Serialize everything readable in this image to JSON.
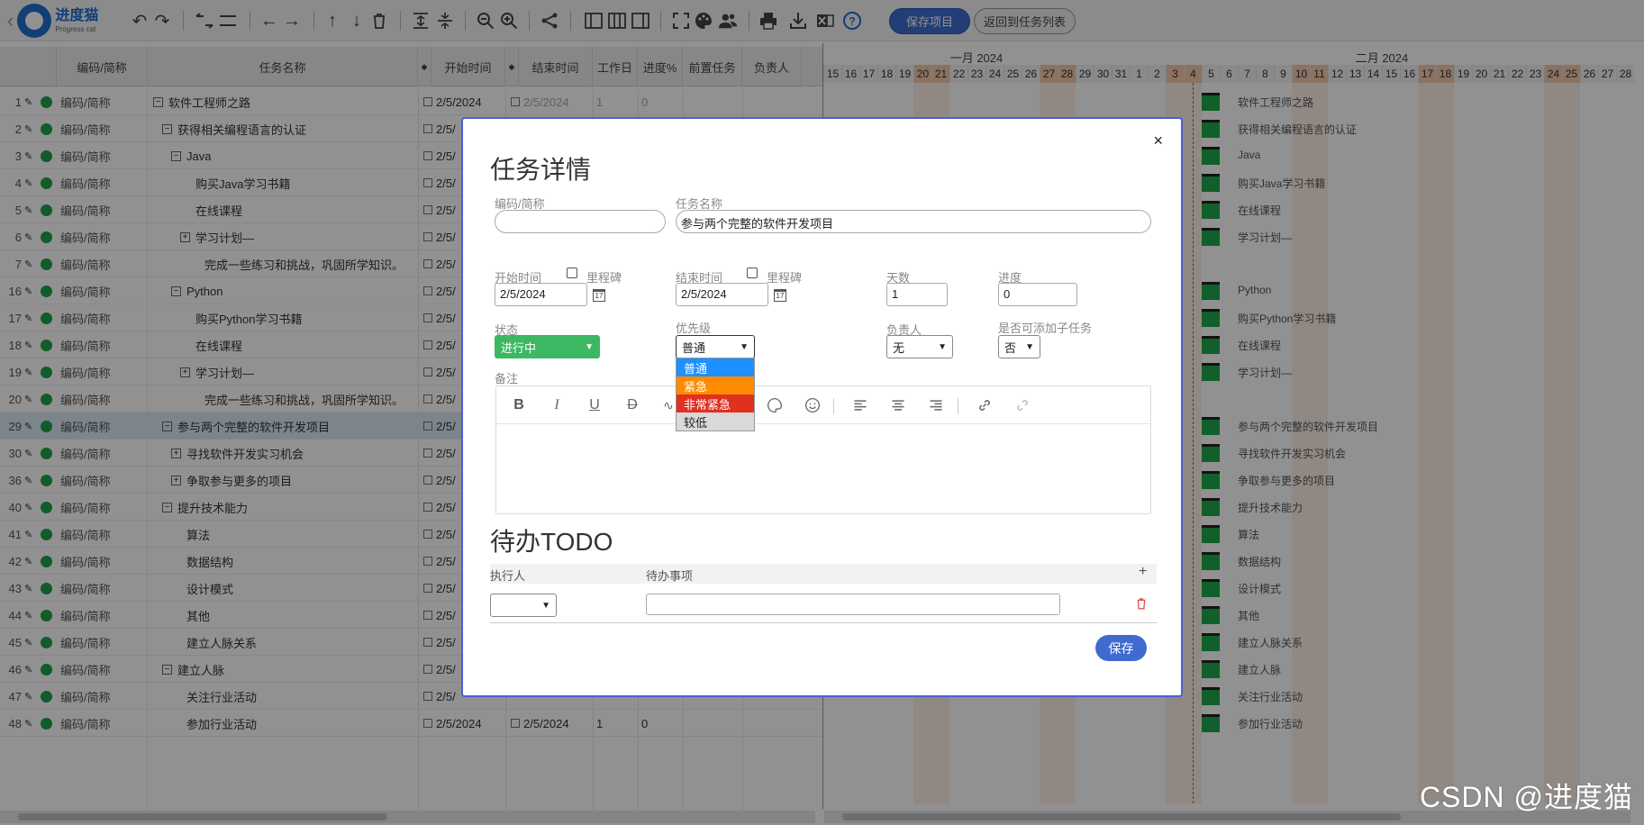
{
  "app": {
    "logo_cn": "进度猫",
    "logo_en": "Progress cat",
    "save_project_label": "保存项目",
    "return_label": "返回到任务列表"
  },
  "grid": {
    "columns": {
      "code": "编码/简称",
      "name": "任务名称",
      "start": "开始时间",
      "end": "结束时间",
      "workdays": "工作日",
      "progress": "进度%",
      "predecessor": "前置任务",
      "owner": "负责人"
    },
    "rows": [
      {
        "id": "1",
        "code": "编码/简称",
        "name": "软件工程师之路",
        "indent": 0,
        "toggle": "−",
        "start": "2/5/2024",
        "end": "2/5/2024",
        "wd": "1",
        "progress": "0"
      },
      {
        "id": "2",
        "code": "编码/简称",
        "name": "获得相关编程语言的认证",
        "indent": 1,
        "toggle": "−",
        "start": "2/5/"
      },
      {
        "id": "3",
        "code": "编码/简称",
        "name": "Java",
        "indent": 2,
        "toggle": "−",
        "start": "2/5/"
      },
      {
        "id": "4",
        "code": "编码/简称",
        "name": "购买Java学习书籍",
        "indent": 3,
        "toggle": "",
        "start": "2/5/"
      },
      {
        "id": "5",
        "code": "编码/简称",
        "name": "在线课程",
        "indent": 3,
        "toggle": "",
        "start": "2/5/"
      },
      {
        "id": "6",
        "code": "编码/简称",
        "name": "学习计划—",
        "indent": 3,
        "toggle": "+",
        "start": "2/5/"
      },
      {
        "id": "7",
        "code": "编码/简称",
        "name": "完成一些练习和挑战，巩固所学知识。",
        "indent": 4,
        "toggle": "",
        "start": "2/5/"
      },
      {
        "id": "16",
        "code": "编码/简称",
        "name": "Python",
        "indent": 2,
        "toggle": "−",
        "start": "2/5/"
      },
      {
        "id": "17",
        "code": "编码/简称",
        "name": "购买Python学习书籍",
        "indent": 3,
        "toggle": "",
        "start": "2/5/"
      },
      {
        "id": "18",
        "code": "编码/简称",
        "name": "在线课程",
        "indent": 3,
        "toggle": "",
        "start": "2/5/"
      },
      {
        "id": "19",
        "code": "编码/简称",
        "name": "学习计划—",
        "indent": 3,
        "toggle": "+",
        "start": "2/5/"
      },
      {
        "id": "20",
        "code": "编码/简称",
        "name": "完成一些练习和挑战，巩固所学知识。",
        "indent": 4,
        "toggle": "",
        "start": "2/5/"
      },
      {
        "id": "29",
        "code": "编码/简称",
        "name": "参与两个完整的软件开发项目",
        "indent": 1,
        "toggle": "−",
        "start": "2/5/",
        "selected": true
      },
      {
        "id": "30",
        "code": "编码/简称",
        "name": "寻找软件开发实习机会",
        "indent": 2,
        "toggle": "+",
        "start": "2/5/"
      },
      {
        "id": "36",
        "code": "编码/简称",
        "name": "争取参与更多的项目",
        "indent": 2,
        "toggle": "+",
        "start": "2/5/"
      },
      {
        "id": "40",
        "code": "编码/简称",
        "name": "提升技术能力",
        "indent": 1,
        "toggle": "−",
        "start": "2/5/"
      },
      {
        "id": "41",
        "code": "编码/简称",
        "name": "算法",
        "indent": 2,
        "toggle": "",
        "start": "2/5/"
      },
      {
        "id": "42",
        "code": "编码/简称",
        "name": "数据结构",
        "indent": 2,
        "toggle": "",
        "start": "2/5/"
      },
      {
        "id": "43",
        "code": "编码/简称",
        "name": "设计模式",
        "indent": 2,
        "toggle": "",
        "start": "2/5/"
      },
      {
        "id": "44",
        "code": "编码/简称",
        "name": "其他",
        "indent": 2,
        "toggle": "",
        "start": "2/5/"
      },
      {
        "id": "45",
        "code": "编码/简称",
        "name": "建立人脉关系",
        "indent": 2,
        "toggle": "",
        "start": "2/5/"
      },
      {
        "id": "46",
        "code": "编码/简称",
        "name": "建立人脉",
        "indent": 1,
        "toggle": "−",
        "start": "2/5/"
      },
      {
        "id": "47",
        "code": "编码/简称",
        "name": "关注行业活动",
        "indent": 2,
        "toggle": "",
        "start": "2/5/"
      },
      {
        "id": "48",
        "code": "编码/简称",
        "name": "参加行业活动",
        "indent": 2,
        "toggle": "",
        "start": "2/5/2024",
        "end": "2/5/2024",
        "wd": "1",
        "progress": "0"
      }
    ]
  },
  "gantt": {
    "month1": "一月 2024",
    "month2": "二月 2024",
    "days": [
      "15",
      "16",
      "17",
      "18",
      "19",
      "20",
      "21",
      "22",
      "23",
      "24",
      "25",
      "26",
      "27",
      "28",
      "29",
      "30",
      "31",
      "1",
      "2",
      "3",
      "4",
      "5",
      "6",
      "7",
      "8",
      "9",
      "10",
      "11",
      "12",
      "13",
      "14",
      "15",
      "16",
      "17",
      "18",
      "19",
      "20",
      "21",
      "22",
      "23",
      "24",
      "25",
      "26",
      "27",
      "28"
    ],
    "labels": [
      "软件工程师之路",
      "获得相关编程语言的认证",
      "Java",
      "购买Java学习书籍",
      "在线课程",
      "学习计划—",
      "",
      "Python",
      "购买Python学习书籍",
      "在线课程",
      "学习计划—",
      "",
      "参与两个完整的软件开发项目",
      "寻找软件开发实习机会",
      "争取参与更多的项目",
      "提升技术能力",
      "算法",
      "数据结构",
      "设计模式",
      "其他",
      "建立人脉关系",
      "建立人脉",
      "关注行业活动",
      "参加行业活动"
    ]
  },
  "modal": {
    "title": "任务详情",
    "close": "×",
    "code_label": "编码/简称",
    "code_value": "",
    "name_label": "任务名称",
    "name_value": "参与两个完整的软件开发项目",
    "start_label": "开始时间",
    "start_milestone": "里程碑",
    "start_value": "2/5/2024",
    "end_label": "结束时间",
    "end_milestone": "里程碑",
    "end_value": "2/5/2024",
    "days_label": "天数",
    "days_value": "1",
    "progress_label": "进度",
    "progress_value": "0",
    "status_label": "状态",
    "status_value": "进行中",
    "priority_label": "优先级",
    "priority_value": "普通",
    "priority_options": [
      {
        "label": "普通",
        "bg": "#1e90ff",
        "fg": "#ffffff"
      },
      {
        "label": "紧急",
        "bg": "#ff8c00",
        "fg": "#ffffff"
      },
      {
        "label": "非常紧急",
        "bg": "#e03020",
        "fg": "#ffffff"
      },
      {
        "label": "较低",
        "bg": "#d9d9d9",
        "fg": "#222222"
      }
    ],
    "owner_label": "负责人",
    "owner_value": "无",
    "subtask_label": "是否可添加子任务",
    "subtask_value": "否",
    "notes_label": "备注",
    "todo_title": "待办TODO",
    "todo_executor": "执行人",
    "todo_item": "待办事项",
    "todo_add": "+",
    "save_label": "保存"
  },
  "watermark": "CSDN @进度猫",
  "colors": {
    "accent": "#3f6bd0",
    "status_green": "#3cb862",
    "gantt_bar": "#1fa84a",
    "weekend": "#f6c9a9"
  }
}
